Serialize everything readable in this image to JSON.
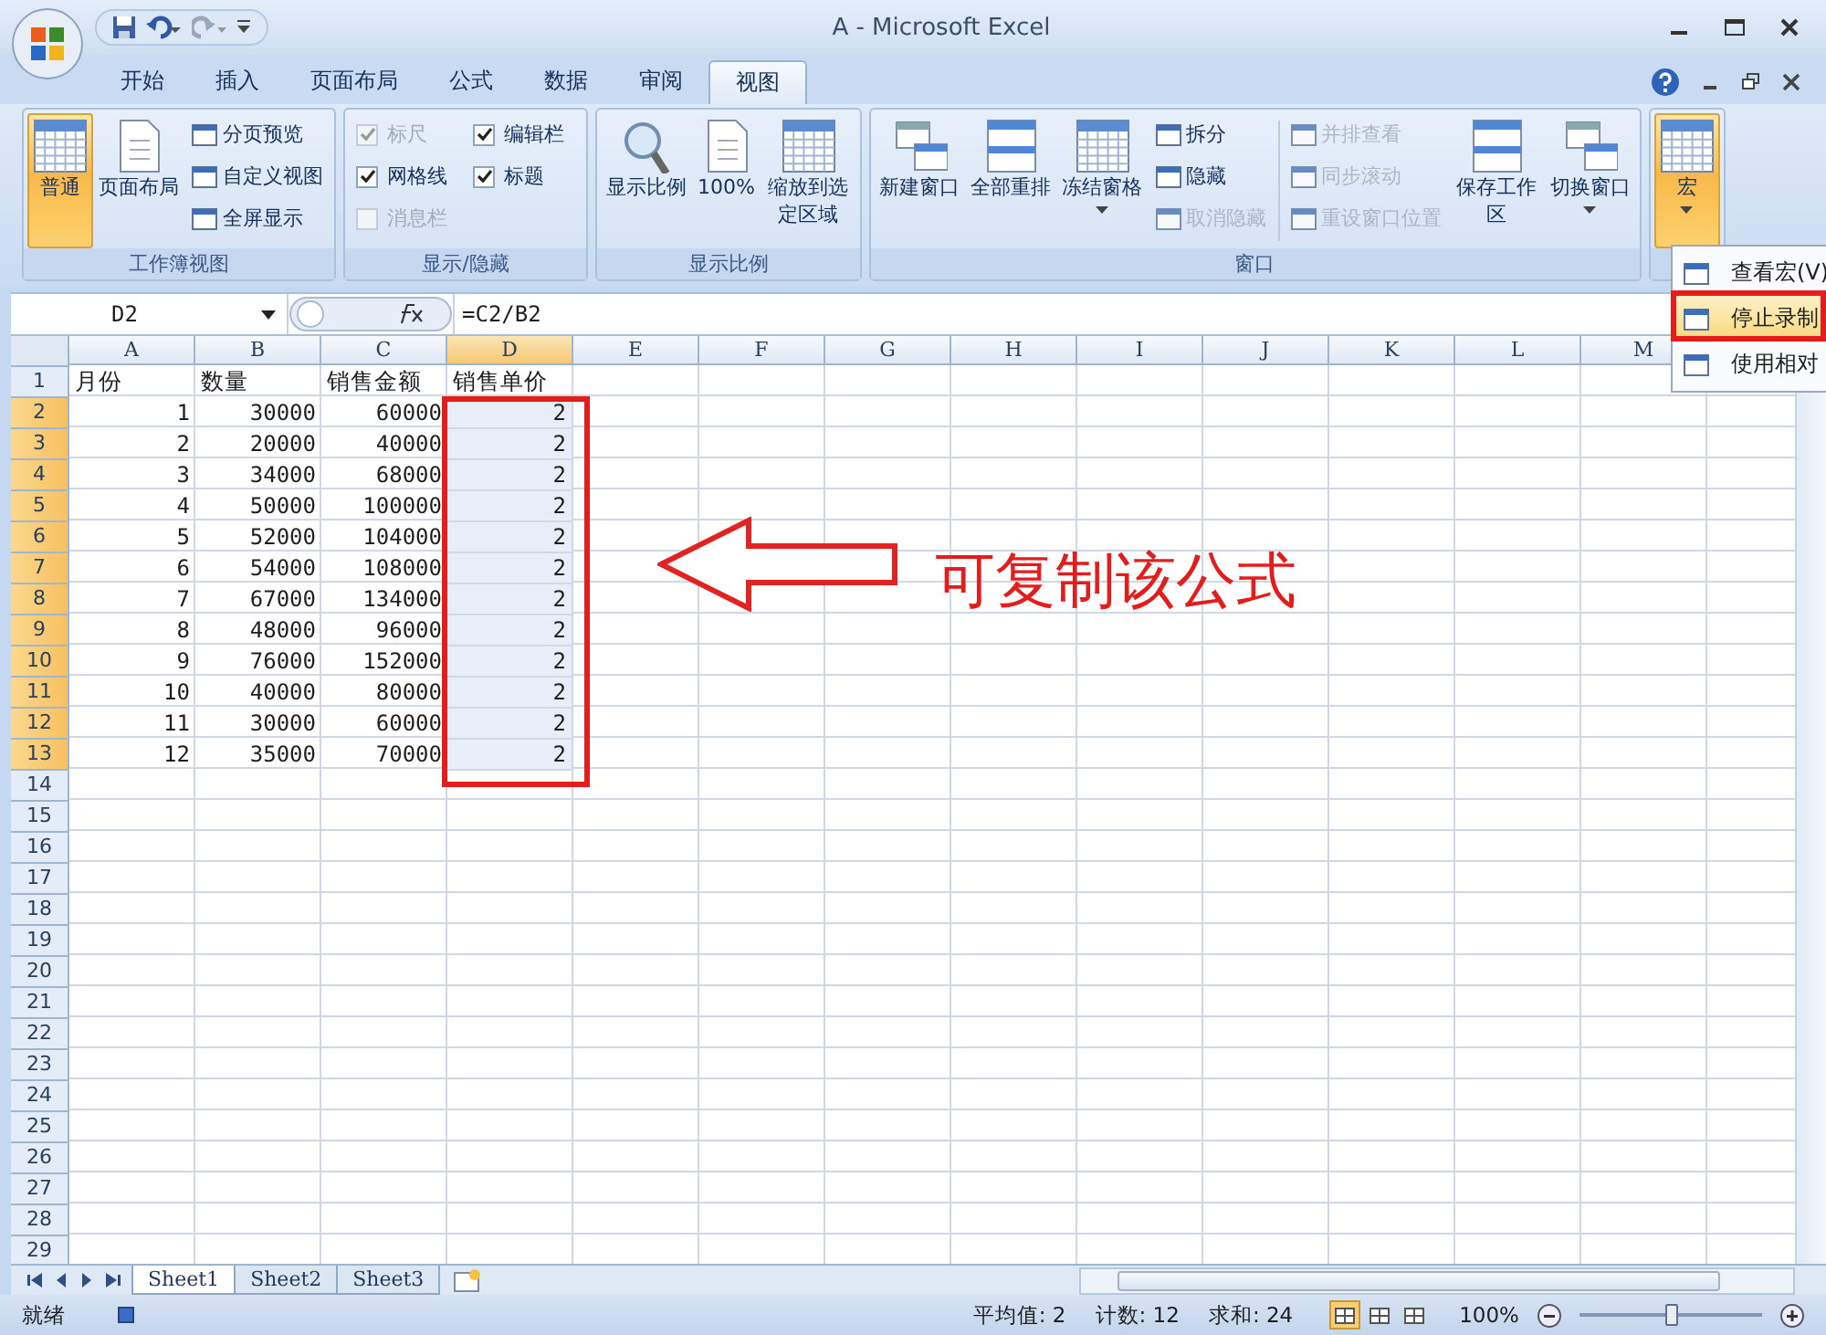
{
  "window": {
    "title": "A - Microsoft Excel"
  },
  "tabs": [
    {
      "label": "开始",
      "selected": false
    },
    {
      "label": "插入",
      "selected": false
    },
    {
      "label": "页面布局",
      "selected": false
    },
    {
      "label": "公式",
      "selected": false
    },
    {
      "label": "数据",
      "selected": false
    },
    {
      "label": "审阅",
      "selected": false
    },
    {
      "label": "视图",
      "selected": true
    }
  ],
  "ribbon_groups": [
    {
      "label": "工作簿视图",
      "items": [
        {
          "kind": "large",
          "label": "普通",
          "selected": true
        },
        {
          "kind": "large",
          "label": "页面布局",
          "selected": false
        },
        {
          "kind": "small",
          "label": "分页预览",
          "disabled": false
        },
        {
          "kind": "small",
          "label": "自定义视图",
          "disabled": false
        },
        {
          "kind": "small",
          "label": "全屏显示",
          "disabled": false
        }
      ]
    },
    {
      "label": "显示/隐藏",
      "items": [
        {
          "kind": "check",
          "label": "标尺",
          "checked": true,
          "disabled": true
        },
        {
          "kind": "check",
          "label": "网格线",
          "checked": true,
          "disabled": false
        },
        {
          "kind": "check",
          "label": "消息栏",
          "checked": false,
          "disabled": true
        },
        {
          "kind": "check",
          "label": "编辑栏",
          "checked": true,
          "disabled": false
        },
        {
          "kind": "check",
          "label": "标题",
          "checked": true,
          "disabled": false
        }
      ]
    },
    {
      "label": "显示比例",
      "items": [
        {
          "kind": "large",
          "label": "显示比例",
          "selected": false
        },
        {
          "kind": "large",
          "label": "100%",
          "selected": false
        },
        {
          "kind": "large",
          "label": "缩放到选定区域",
          "selected": false
        }
      ]
    },
    {
      "label": "窗口",
      "items": [
        {
          "kind": "large",
          "label": "新建窗口",
          "selected": false
        },
        {
          "kind": "large",
          "label": "全部重排",
          "selected": false
        },
        {
          "kind": "large",
          "label": "冻结窗格",
          "selected": false,
          "dropdown": true
        },
        {
          "kind": "small",
          "label": "拆分",
          "disabled": false
        },
        {
          "kind": "small",
          "label": "隐藏",
          "disabled": false
        },
        {
          "kind": "small",
          "label": "取消隐藏",
          "disabled": true
        },
        {
          "kind": "small",
          "label": "并排查看",
          "disabled": true
        },
        {
          "kind": "small",
          "label": "同步滚动",
          "disabled": true
        },
        {
          "kind": "small",
          "label": "重设窗口位置",
          "disabled": true
        },
        {
          "kind": "large",
          "label": "保存工作区",
          "selected": false
        },
        {
          "kind": "large",
          "label": "切换窗口",
          "selected": false,
          "dropdown": true
        }
      ]
    },
    {
      "items": [
        {
          "kind": "large",
          "label": "宏",
          "selected": true,
          "dropdown": true
        }
      ]
    }
  ],
  "formula_bar": {
    "name_box": "D2",
    "formula": "=C2/B2"
  },
  "sheet": {
    "columns": [
      {
        "label": "A",
        "selected": false
      },
      {
        "label": "B",
        "selected": false
      },
      {
        "label": "C",
        "selected": false
      },
      {
        "label": "D",
        "selected": true
      },
      {
        "label": "E",
        "selected": false
      },
      {
        "label": "F",
        "selected": false
      },
      {
        "label": "G",
        "selected": false
      },
      {
        "label": "H",
        "selected": false
      },
      {
        "label": "I",
        "selected": false
      },
      {
        "label": "J",
        "selected": false
      },
      {
        "label": "K",
        "selected": false
      },
      {
        "label": "L",
        "selected": false
      },
      {
        "label": "M",
        "selected": false
      }
    ],
    "rows": [
      {
        "header": "1",
        "selected": false,
        "kind": "text",
        "cells": [
          "月份",
          "数量",
          "销售金额",
          "销售单价"
        ]
      },
      {
        "header": "2",
        "selected": true,
        "kind": "number",
        "cells": [
          "1",
          "30000",
          "60000",
          "2"
        ]
      },
      {
        "header": "3",
        "selected": true,
        "kind": "number",
        "cells": [
          "2",
          "20000",
          "40000",
          "2"
        ]
      },
      {
        "header": "4",
        "selected": true,
        "kind": "number",
        "cells": [
          "3",
          "34000",
          "68000",
          "2"
        ]
      },
      {
        "header": "5",
        "selected": true,
        "kind": "number",
        "cells": [
          "4",
          "50000",
          "100000",
          "2"
        ]
      },
      {
        "header": "6",
        "selected": true,
        "kind": "number",
        "cells": [
          "5",
          "52000",
          "104000",
          "2"
        ]
      },
      {
        "header": "7",
        "selected": true,
        "kind": "number",
        "cells": [
          "6",
          "54000",
          "108000",
          "2"
        ]
      },
      {
        "header": "8",
        "selected": true,
        "kind": "number",
        "cells": [
          "7",
          "67000",
          "134000",
          "2"
        ]
      },
      {
        "header": "9",
        "selected": true,
        "kind": "number",
        "cells": [
          "8",
          "48000",
          "96000",
          "2"
        ]
      },
      {
        "header": "10",
        "selected": true,
        "kind": "number",
        "cells": [
          "9",
          "76000",
          "152000",
          "2"
        ]
      },
      {
        "header": "11",
        "selected": true,
        "kind": "number",
        "cells": [
          "10",
          "40000",
          "80000",
          "2"
        ]
      },
      {
        "header": "12",
        "selected": true,
        "kind": "number",
        "cells": [
          "11",
          "30000",
          "60000",
          "2"
        ]
      },
      {
        "header": "13",
        "selected": true,
        "kind": "number",
        "cells": [
          "12",
          "35000",
          "70000",
          "2"
        ]
      },
      {
        "header": "14",
        "selected": false
      },
      {
        "header": "15",
        "selected": false
      },
      {
        "header": "16",
        "selected": false
      },
      {
        "header": "17",
        "selected": false
      },
      {
        "header": "18",
        "selected": false
      },
      {
        "header": "19",
        "selected": false
      },
      {
        "header": "20",
        "selected": false
      },
      {
        "header": "21",
        "selected": false
      },
      {
        "header": "22",
        "selected": false
      },
      {
        "header": "23",
        "selected": false
      },
      {
        "header": "24",
        "selected": false
      },
      {
        "header": "25",
        "selected": false
      },
      {
        "header": "26",
        "selected": false
      },
      {
        "header": "27",
        "selected": false
      },
      {
        "header": "28",
        "selected": false
      },
      {
        "header": "29",
        "selected": false
      }
    ]
  },
  "sheet_tabs": [
    {
      "label": "Sheet1",
      "selected": true
    },
    {
      "label": "Sheet2",
      "selected": false
    },
    {
      "label": "Sheet3",
      "selected": false
    }
  ],
  "status_bar": {
    "status": "就绪",
    "average": "平均值: 2",
    "count": "计数: 12",
    "sum": "求和: 24",
    "views": [
      {
        "selected": true
      },
      {
        "selected": false
      },
      {
        "selected": false
      }
    ],
    "zoom": "100%",
    "zoom_level": {
      "level": 0.5
    }
  },
  "macro_menu": [
    {
      "label": "查看宏(V)",
      "selected": false
    },
    {
      "label": "停止录制",
      "selected": true
    },
    {
      "label": "使用相对",
      "selected": false
    }
  ],
  "annotation": {
    "text": "可复制该公式"
  }
}
